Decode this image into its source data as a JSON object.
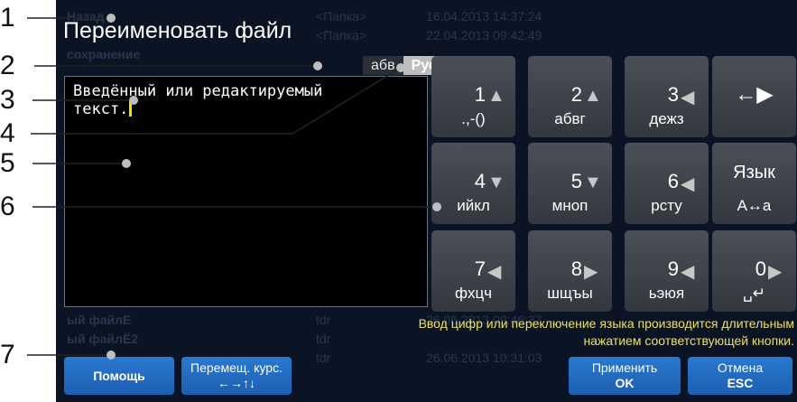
{
  "background_list": [
    {
      "name": "Назад",
      "type": "<Папка>",
      "date": "16.04.2013 14:37:24"
    },
    {
      "name": "",
      "type": "<Папка>",
      "date": "22.04.2013 09:42:49"
    },
    {
      "name": "сохранение",
      "type": "",
      "date": ""
    },
    {
      "name": "",
      "type": "",
      "date": ""
    },
    {
      "name": "",
      "type": "",
      "date": ""
    },
    {
      "name": "",
      "type": "",
      "date": ""
    },
    {
      "name": "",
      "type": "",
      "date": ""
    },
    {
      "name": "",
      "type": "",
      "date": ""
    },
    {
      "name": "",
      "type": "",
      "date": ""
    },
    {
      "name": "",
      "type": "",
      "date": ""
    },
    {
      "name": "",
      "type": "",
      "date": ""
    },
    {
      "name": "",
      "type": "",
      "date": ""
    },
    {
      "name": "",
      "type": "",
      "date": ""
    },
    {
      "name": "",
      "type": "",
      "date": ""
    },
    {
      "name": "",
      "type": "",
      "date": ""
    },
    {
      "name": "",
      "type": "",
      "date": ""
    },
    {
      "name": "ый файлЕ",
      "type": "tdr",
      "date": "26.06.2013 09:46:37"
    },
    {
      "name": "ый файлЁ2",
      "type": "tdr",
      "date": ""
    },
    {
      "name": "",
      "type": "tdr",
      "date": "26.06.2013 10:31:03"
    }
  ],
  "dialog": {
    "title": "Переименовать файл",
    "lang_tabs": [
      "абв",
      "Рус"
    ],
    "active_lang": 1,
    "text": "Введённый или редактируемый\nтекст."
  },
  "keys": [
    {
      "num": "1",
      "arrow": "▲",
      "letters": ".,-()"
    },
    {
      "num": "2",
      "arrow": "▲",
      "letters": "абвг"
    },
    {
      "num": "3",
      "arrow": "◀",
      "letters": "дежз"
    },
    {
      "icon": "←▶",
      "name": "backspace"
    },
    {
      "num": "4",
      "arrow": "▼",
      "letters": "ийкл"
    },
    {
      "num": "5",
      "arrow": "▼",
      "letters": "мноп"
    },
    {
      "num": "6",
      "arrow": "◀",
      "letters": "рсту"
    },
    {
      "top": "Язык",
      "bottom": "A↔a",
      "name": "language"
    },
    {
      "num": "7",
      "arrow": "◀",
      "letters": "фхцч"
    },
    {
      "num": "8",
      "arrow": "▶",
      "letters": "шщъы"
    },
    {
      "num": "9",
      "arrow": "◀",
      "letters": "ьэюя"
    },
    {
      "num": "0",
      "arrow": "▶",
      "letters": "␣↵"
    }
  ],
  "hint": "Ввод цифр или переключение языка производится длительным нажатием соответствующей кнопки.",
  "buttons": {
    "help": "Помощь",
    "move_cursor": "Перемещ. курс.",
    "move_cursor_arrows": "←→↑↓",
    "apply": "Применить",
    "apply_sub": "OK",
    "cancel": "Отмена",
    "cancel_sub": "ESC"
  },
  "callouts": [
    "1",
    "2",
    "3",
    "4",
    "5",
    "6",
    "7"
  ],
  "colors": {
    "screen_bg": "#0b1424",
    "button_blue": "#1d5fb2",
    "hint_yellow": "#eee05c",
    "caret": "#f5e000"
  }
}
